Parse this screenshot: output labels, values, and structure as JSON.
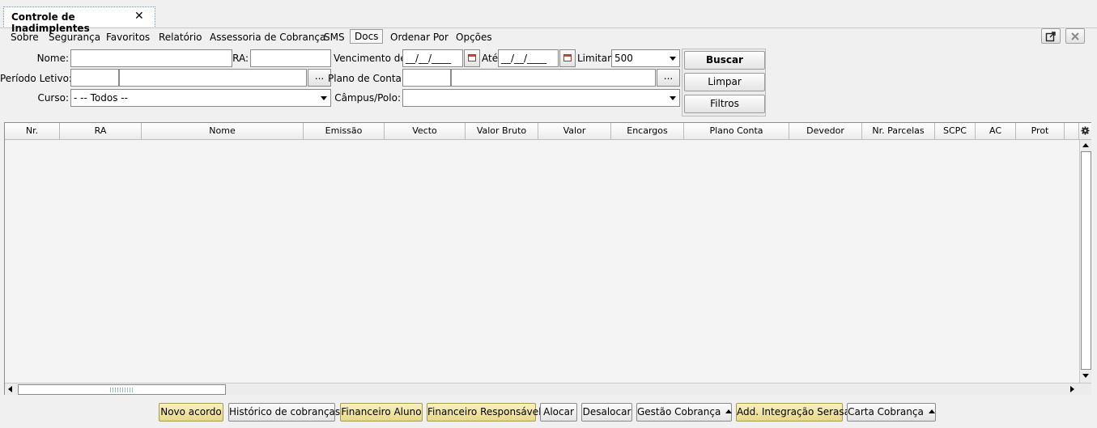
{
  "tab": {
    "title": "Controle de Inadimplentes",
    "close": "✕"
  },
  "menu": [
    "Sobre",
    "Segurança",
    "Favoritos",
    "Relatório",
    "Assessoria de Cobrança",
    "SMS",
    "Docs",
    "Ordenar Por",
    "Opções"
  ],
  "filters": {
    "nome_label": "Nome:",
    "nome_value": "",
    "ra_label": "RA:",
    "ra_value": "",
    "venc_label": "Vencimento de:",
    "venc_de": "__/__/____",
    "ate_label": "Até",
    "venc_ate": "__/__/____",
    "limitar_label": "Limitar:",
    "limitar_value": "500",
    "periodo_label": "Período Letivo:",
    "plano_label": "Plano de Conta:",
    "curso_label": "Curso:",
    "curso_value": "- -- Todos --",
    "campus_label": "Câmpus/Polo:",
    "campus_value": "",
    "ellipsis": "..."
  },
  "actions": {
    "buscar": "Buscar",
    "limpar": "Limpar",
    "filtros": "Filtros"
  },
  "table": {
    "columns": [
      "Nr.",
      "RA",
      "Nome",
      "Emissão",
      "Vecto",
      "Valor Bruto",
      "Valor",
      "Encargos",
      "Plano Conta",
      "Devedor",
      "Nr. Parcelas",
      "SCPC",
      "AC",
      "Prot"
    ],
    "rows": []
  },
  "footer": {
    "buttons": [
      "Novo acordo",
      "Histórico de cobranças",
      "Financeiro Aluno",
      "Financeiro Responsável",
      "Alocar",
      "Desalocar",
      "Gestão Cobrança",
      "Add. Integração Serasa",
      "Carta Cobrança"
    ]
  },
  "colors": {
    "highlight_button": "#e8d98a",
    "tab_border": "#6b8fc9"
  },
  "icons": [
    "close-icon",
    "calendar-icon",
    "settings-gear-icon",
    "detach-window-icon",
    "close-window-icon"
  ]
}
